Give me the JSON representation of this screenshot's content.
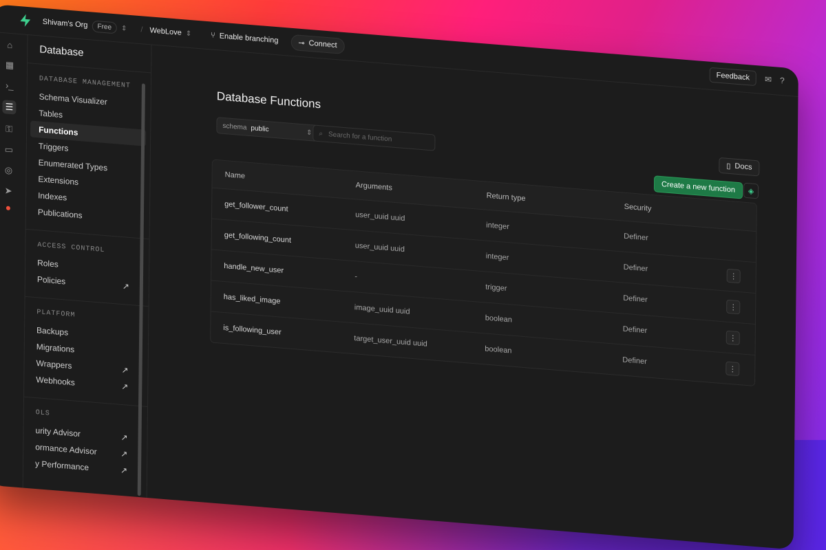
{
  "topbar": {
    "org": "Shivam's Org",
    "plan": "Free",
    "project": "WebLove",
    "branching": "Enable branching",
    "connect": "Connect",
    "feedback": "Feedback"
  },
  "sidebar": {
    "title": "Database",
    "sections": [
      {
        "label": "DATABASE MANAGEMENT",
        "items": [
          "Schema Visualizer",
          "Tables",
          "Functions",
          "Triggers",
          "Enumerated Types",
          "Extensions",
          "Indexes",
          "Publications"
        ]
      },
      {
        "label": "ACCESS CONTROL",
        "items": [
          "Roles",
          "Policies"
        ]
      },
      {
        "label": "PLATFORM",
        "items": [
          "Backups",
          "Migrations",
          "Wrappers",
          "Webhooks"
        ]
      },
      {
        "label": "OLS",
        "items": [
          "urity Advisor",
          "ormance Advisor",
          "y Performance"
        ]
      }
    ]
  },
  "main": {
    "title": "Database Functions",
    "schema_prefix": "schema",
    "schema_value": "public",
    "search_placeholder": "Search for a function",
    "docs_label": "Docs",
    "create_label": "Create a new function",
    "columns": [
      "Name",
      "Arguments",
      "Return type",
      "Security"
    ],
    "rows": [
      {
        "name": "get_follower_count",
        "args": "user_uuid uuid",
        "ret": "integer",
        "security": "Definer"
      },
      {
        "name": "get_following_count",
        "args": "user_uuid uuid",
        "ret": "integer",
        "security": "Definer"
      },
      {
        "name": "handle_new_user",
        "args": "-",
        "ret": "trigger",
        "security": "Definer"
      },
      {
        "name": "has_liked_image",
        "args": "image_uuid uuid",
        "ret": "boolean",
        "security": "Definer"
      },
      {
        "name": "is_following_user",
        "args": "target_user_uuid uuid",
        "ret": "boolean",
        "security": "Definer"
      }
    ]
  },
  "colors": {
    "brand": "#3ecf8e",
    "accent_button": "#1e7a46",
    "bg": "#1c1c1c"
  }
}
